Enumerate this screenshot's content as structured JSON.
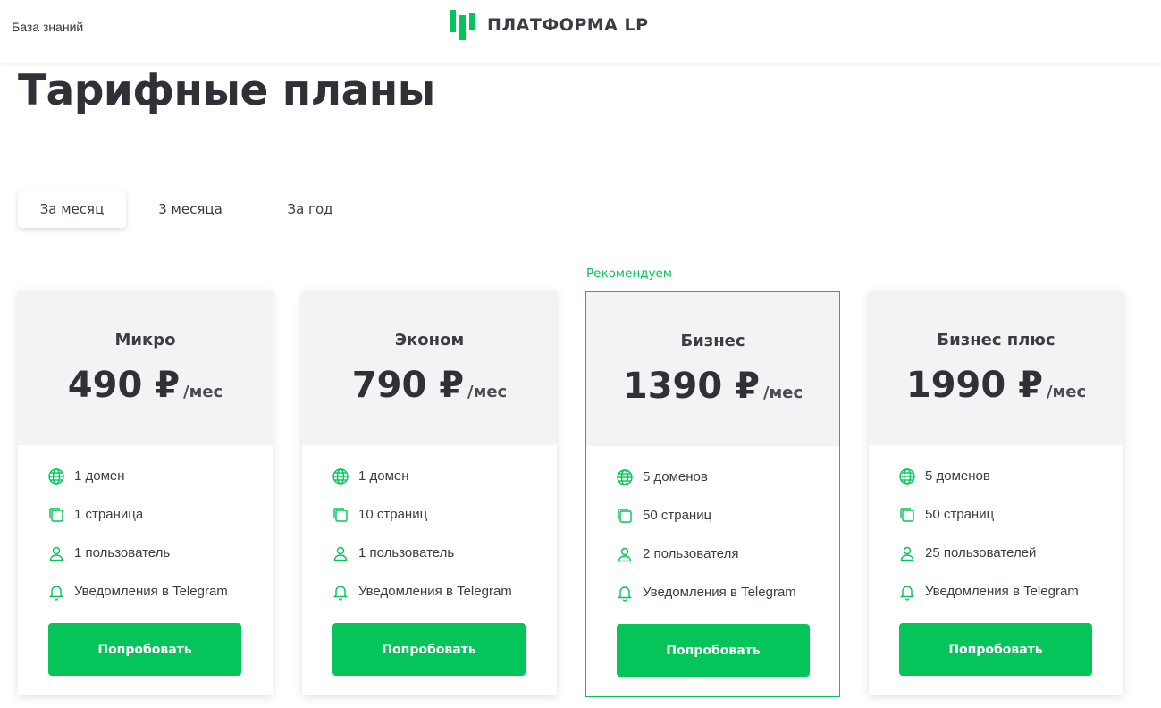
{
  "header": {
    "knowledge_base": "База знаний",
    "logo_text": "ПЛАТФОРМА LP"
  },
  "page_title": "Тарифные планы",
  "tabs": [
    {
      "label": "За месяц",
      "active": true
    },
    {
      "label": "3 месяца",
      "active": false
    },
    {
      "label": "За год",
      "active": false
    }
  ],
  "recommend_label": "Рекомендуем",
  "plans": [
    {
      "name": "Микро",
      "price": "490 ₽",
      "period": "/мес",
      "features": [
        {
          "icon": "globe-icon",
          "text": "1 домен"
        },
        {
          "icon": "pages-icon",
          "text": "1 страница"
        },
        {
          "icon": "user-icon",
          "text": "1 пользователь"
        },
        {
          "icon": "bell-icon",
          "text": "Уведомления в Telegram"
        }
      ],
      "button": "Попробовать"
    },
    {
      "name": "Эконом",
      "price": "790 ₽",
      "period": "/мес",
      "features": [
        {
          "icon": "globe-icon",
          "text": "1 домен"
        },
        {
          "icon": "pages-icon",
          "text": "10 страниц"
        },
        {
          "icon": "user-icon",
          "text": "1 пользователь"
        },
        {
          "icon": "bell-icon",
          "text": "Уведомления в Telegram"
        }
      ],
      "button": "Попробовать"
    },
    {
      "name": "Бизнес",
      "price": "1390 ₽",
      "period": "/мес",
      "features": [
        {
          "icon": "globe-icon",
          "text": "5 доменов"
        },
        {
          "icon": "pages-icon",
          "text": "50 страниц"
        },
        {
          "icon": "user-icon",
          "text": "2 пользователя"
        },
        {
          "icon": "bell-icon",
          "text": "Уведомления в Telegram"
        }
      ],
      "button": "Попробовать"
    },
    {
      "name": "Бизнес плюс",
      "price": "1990 ₽",
      "period": "/мес",
      "features": [
        {
          "icon": "globe-icon",
          "text": "5 доменов"
        },
        {
          "icon": "pages-icon",
          "text": "50 страниц"
        },
        {
          "icon": "user-icon",
          "text": "25 пользователей"
        },
        {
          "icon": "bell-icon",
          "text": "Уведомления в Telegram"
        }
      ],
      "button": "Попробовать"
    }
  ],
  "colors": {
    "accent": "#05c45a",
    "card_head_bg": "#f2f3f5",
    "text_dark": "#2f3136"
  }
}
